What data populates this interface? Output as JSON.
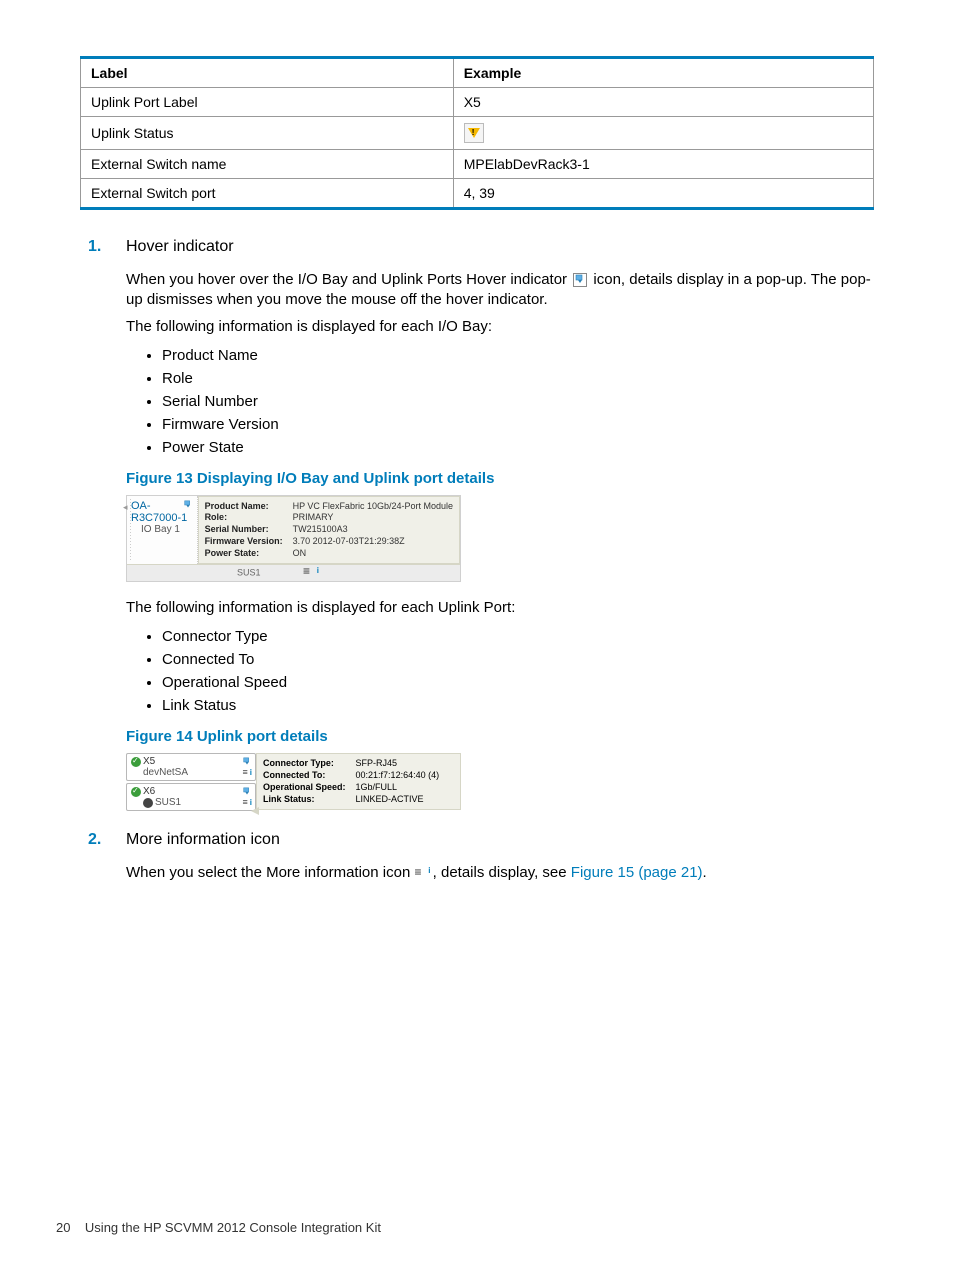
{
  "table": {
    "headers": [
      "Label",
      "Example"
    ],
    "rows": [
      {
        "label": "Uplink Port Label",
        "example": "X5"
      },
      {
        "label": "Uplink Status",
        "example_is_icon": true,
        "icon_name": "warning-triangle"
      },
      {
        "label": "External Switch name",
        "example": "MPElabDevRack3-1"
      },
      {
        "label": "External Switch port",
        "example": "4, 39"
      }
    ]
  },
  "step1": {
    "num": "1.",
    "title": "Hover indicator",
    "para_pre": "When you hover over the I/O Bay and Uplink Ports Hover indicator ",
    "para_post": " icon, details display in a pop-up. The pop-up dismisses when you move the mouse off the hover indicator.",
    "para2": "The following information is displayed for each I/O Bay:",
    "bullets_iobay": [
      "Product Name",
      "Role",
      "Serial Number",
      "Firmware Version",
      "Power State"
    ],
    "fig13_caption": "Figure 13 Displaying I/O Bay and Uplink port details",
    "fig13": {
      "tree_hdr": "OA-R3C7000-1",
      "tree_sub": "IO Bay 1",
      "labels": [
        "Product Name:",
        "Role:",
        "Serial Number:",
        "Firmware Version:",
        "Power State:"
      ],
      "values": [
        "HP VC FlexFabric 10Gb/24-Port Module",
        "PRIMARY",
        "TW215100A3",
        "3.70 2012-07-03T21:29:38Z",
        "ON"
      ],
      "bottom": "SUS1"
    },
    "para3": "The following information is displayed for each Uplink Port:",
    "bullets_uplink": [
      "Connector Type",
      "Connected To",
      "Operational Speed",
      "Link Status"
    ],
    "fig14_caption": "Figure 14 Uplink port details",
    "fig14": {
      "left": [
        {
          "top": "X5",
          "sub": "devNetSA",
          "check": true
        },
        {
          "top": "X6",
          "sub": "SUS1",
          "check": true,
          "dark": true
        }
      ],
      "labels": [
        "Connector Type:",
        "Connected To:",
        "Operational Speed:",
        "Link Status:"
      ],
      "values": [
        "SFP-RJ45",
        "00:21:f7:12:64:40 (4)",
        "1Gb/FULL",
        "LINKED-ACTIVE"
      ]
    }
  },
  "step2": {
    "num": "2.",
    "title": "More information icon",
    "para_pre": "When you select the More information icon ",
    "para_post": ", details display, see ",
    "link": "Figure 15 (page 21)",
    "period": "."
  },
  "footer": {
    "page": "20",
    "title": "Using the HP SCVMM 2012 Console Integration Kit"
  }
}
